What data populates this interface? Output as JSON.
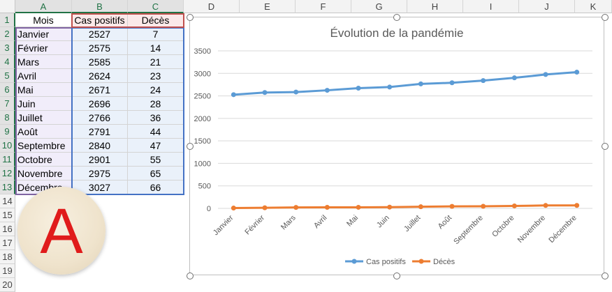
{
  "columns": [
    "A",
    "B",
    "C",
    "D",
    "E",
    "F",
    "G",
    "H",
    "I",
    "J",
    "K"
  ],
  "rows": [
    "1",
    "2",
    "3",
    "4",
    "5",
    "6",
    "7",
    "8",
    "9",
    "10",
    "11",
    "12",
    "13",
    "14",
    "15",
    "16",
    "17",
    "18",
    "19",
    "20"
  ],
  "headers": {
    "a": "Mois",
    "b": "Cas positifs",
    "c": "Décès"
  },
  "table": [
    {
      "a": "Janvier",
      "b": "2527",
      "c": "7"
    },
    {
      "a": "Février",
      "b": "2575",
      "c": "14"
    },
    {
      "a": "Mars",
      "b": "2585",
      "c": "21"
    },
    {
      "a": "Avril",
      "b": "2624",
      "c": "23"
    },
    {
      "a": "Mai",
      "b": "2671",
      "c": "24"
    },
    {
      "a": "Juin",
      "b": "2696",
      "c": "28"
    },
    {
      "a": "Juillet",
      "b": "2766",
      "c": "36"
    },
    {
      "a": "Août",
      "b": "2791",
      "c": "44"
    },
    {
      "a": "Septembre",
      "b": "2840",
      "c": "47"
    },
    {
      "a": "Octobre",
      "b": "2901",
      "c": "55"
    },
    {
      "a": "Novembre",
      "b": "2975",
      "c": "65"
    },
    {
      "a": "Décembre",
      "b": "3027",
      "c": "66"
    }
  ],
  "badge": {
    "letter": "A",
    "color": "#e01b1b"
  },
  "chart_data": {
    "type": "line",
    "title": "Évolution de la pandémie",
    "categories": [
      "Janvier",
      "Février",
      "Mars",
      "Avril",
      "Mai",
      "Juin",
      "Juillet",
      "Août",
      "Septembre",
      "Octobre",
      "Novembre",
      "Décembre"
    ],
    "series": [
      {
        "name": "Cas positifs",
        "color": "#5b9bd5",
        "values": [
          2527,
          2575,
          2585,
          2624,
          2671,
          2696,
          2766,
          2791,
          2840,
          2901,
          2975,
          3027
        ]
      },
      {
        "name": "Décès",
        "color": "#ed7d31",
        "values": [
          7,
          14,
          21,
          23,
          24,
          28,
          36,
          44,
          47,
          55,
          65,
          66
        ]
      }
    ],
    "ylim": [
      0,
      3500
    ],
    "yticks": [
      "0",
      "500",
      "1000",
      "1500",
      "2000",
      "2500",
      "3000",
      "3500"
    ],
    "grid": true,
    "legend": "bottom"
  }
}
